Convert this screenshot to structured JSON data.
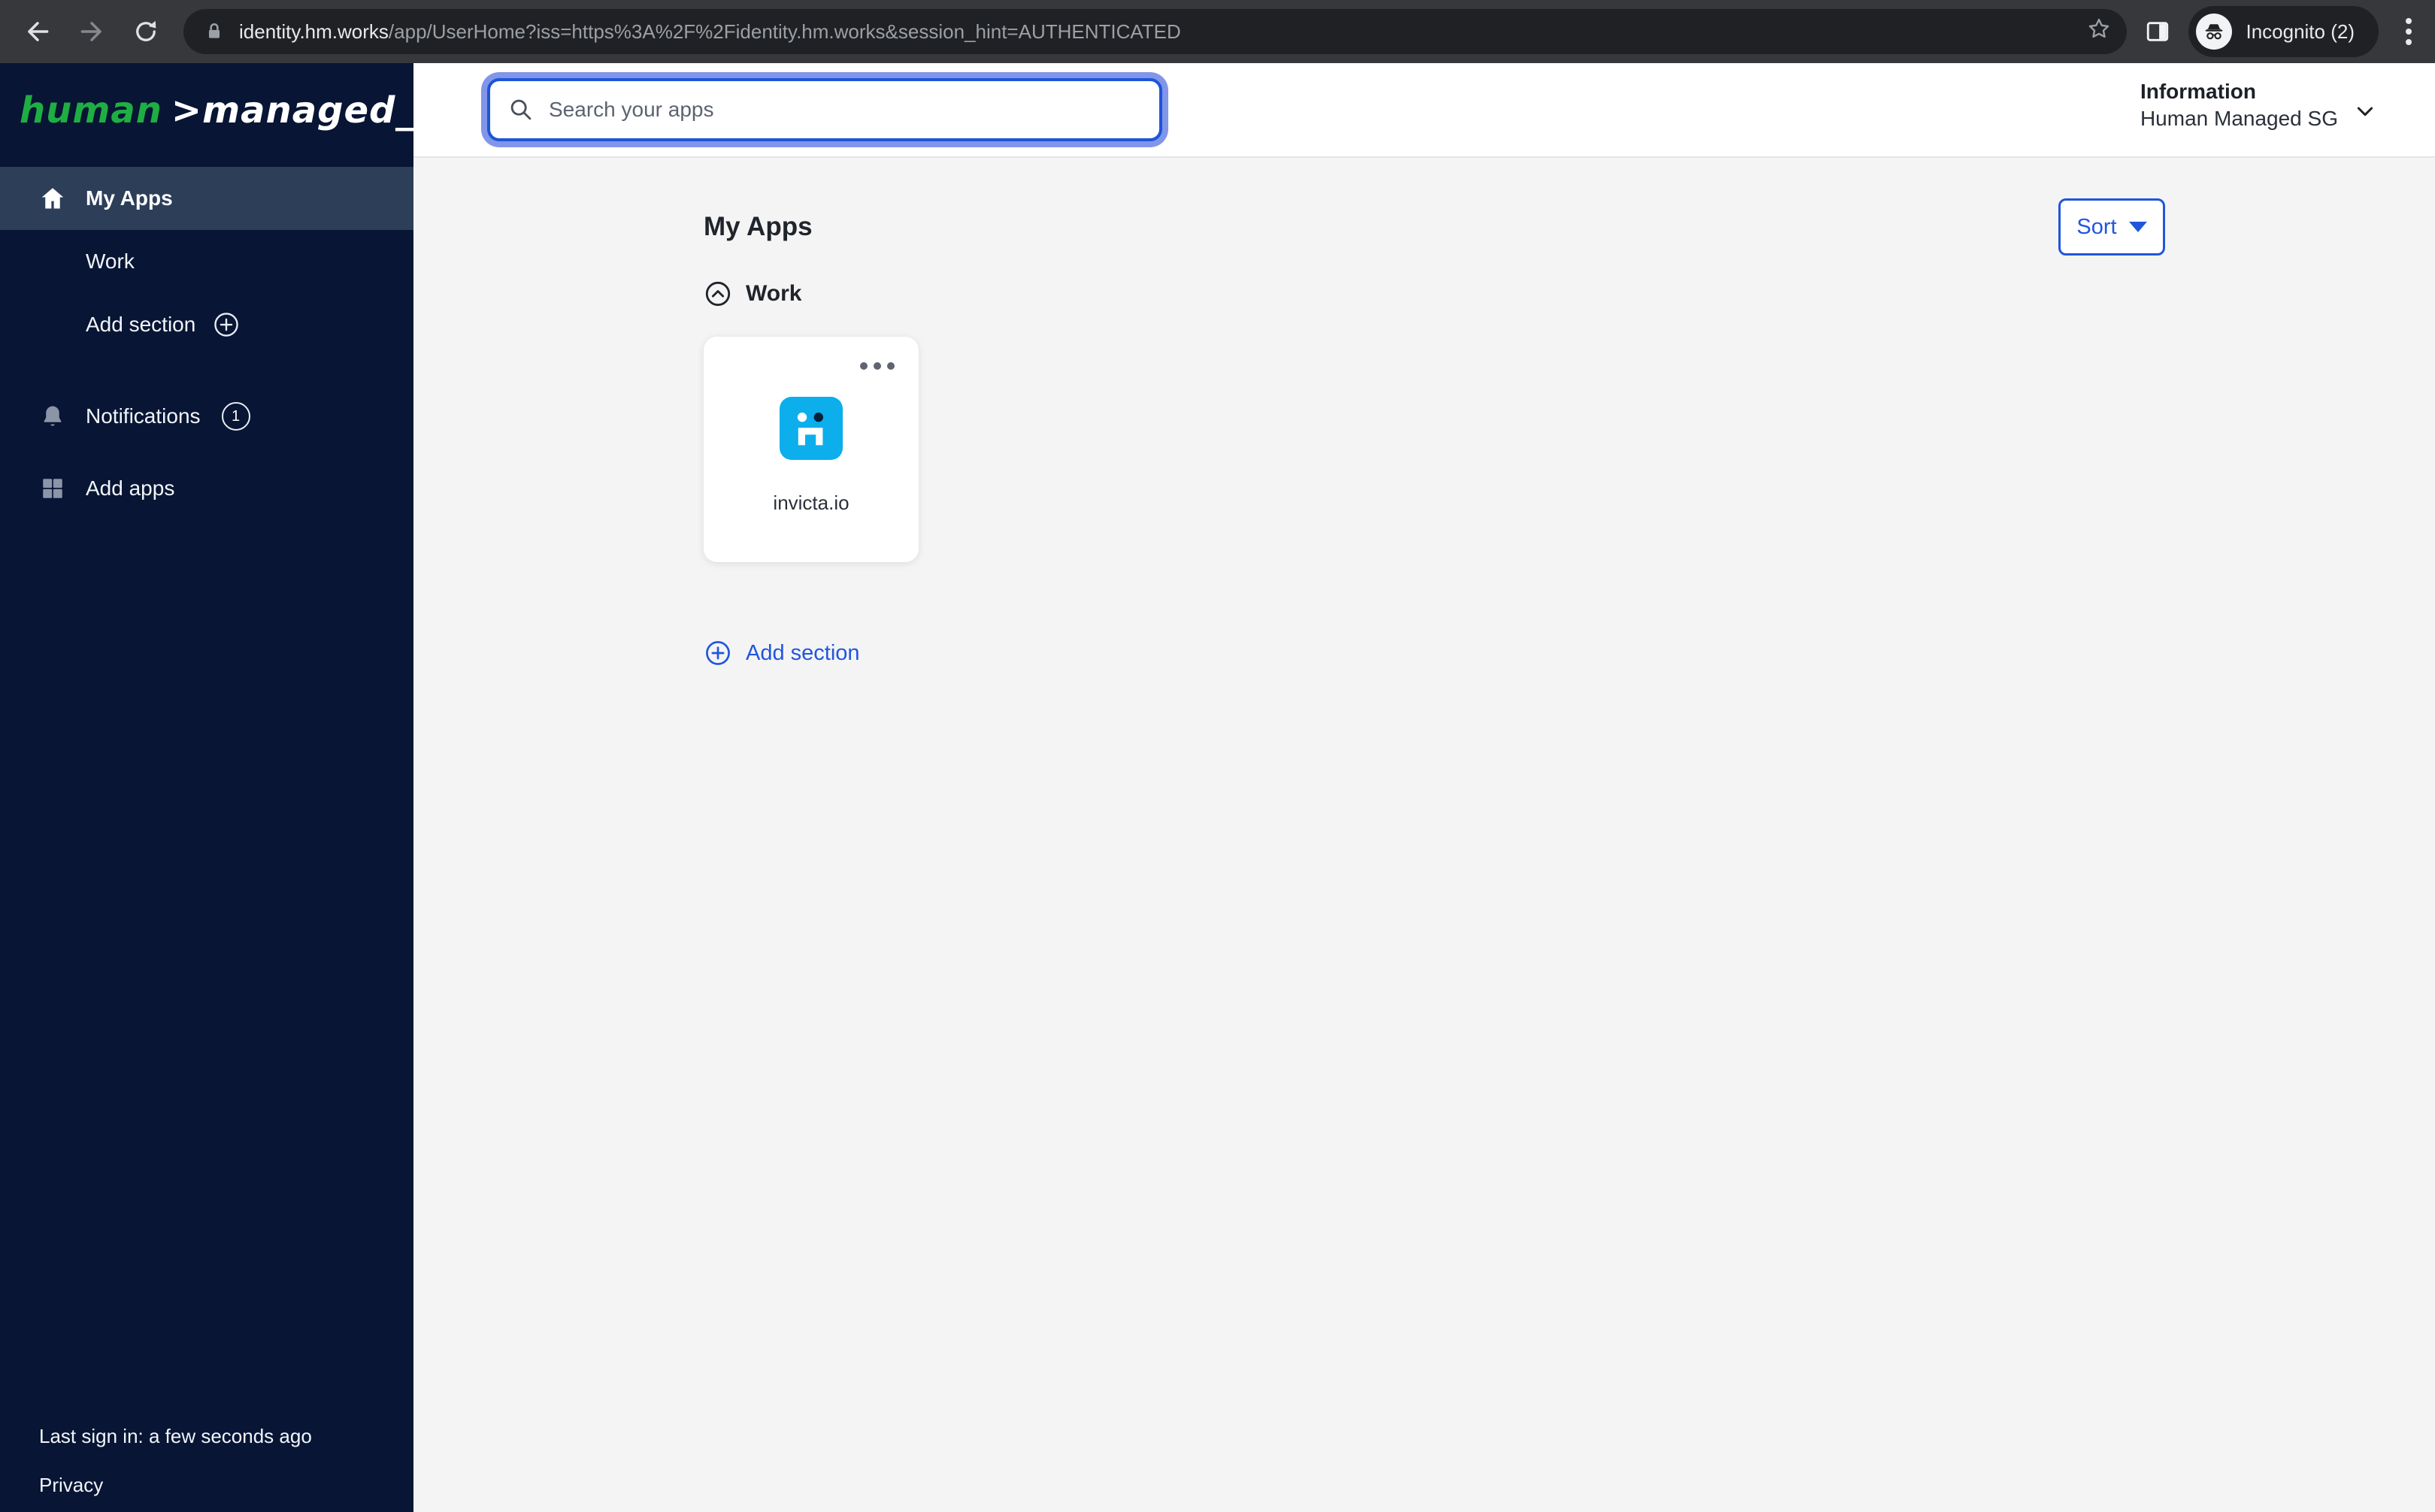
{
  "browser": {
    "url_domain": "identity.hm.works",
    "url_path": "/app/UserHome?iss=https%3A%2F%2Fidentity.hm.works&session_hint=AUTHENTICATED",
    "incognito_label": "Incognito (2)"
  },
  "logo": {
    "part_green": "human",
    "part_white": ">managed_"
  },
  "sidebar": {
    "items": [
      {
        "label": "My Apps",
        "active": true
      },
      {
        "label": "Work"
      },
      {
        "label": "Add section"
      },
      {
        "label": "Notifications",
        "badge": "1"
      },
      {
        "label": "Add apps"
      }
    ],
    "footer": {
      "last_sign_in": "Last sign in: a few seconds ago",
      "privacy": "Privacy"
    }
  },
  "header": {
    "search_placeholder": "Search your apps",
    "org": {
      "title": "Information",
      "name": "Human Managed SG"
    }
  },
  "main": {
    "title": "My Apps",
    "sort_label": "Sort",
    "section_name": "Work",
    "apps": [
      {
        "name": "invicta.io"
      }
    ],
    "add_section_label": "Add section"
  },
  "colors": {
    "accent_blue": "#2056dd",
    "app_icon_blue": "#0caeec",
    "sidebar_navy": "#081534",
    "sidebar_active": "#2d3e59",
    "logo_green": "#1fae43",
    "content_bg": "#f4f4f5",
    "chrome_bg": "#37383c",
    "omnibox_bg": "#202124"
  }
}
